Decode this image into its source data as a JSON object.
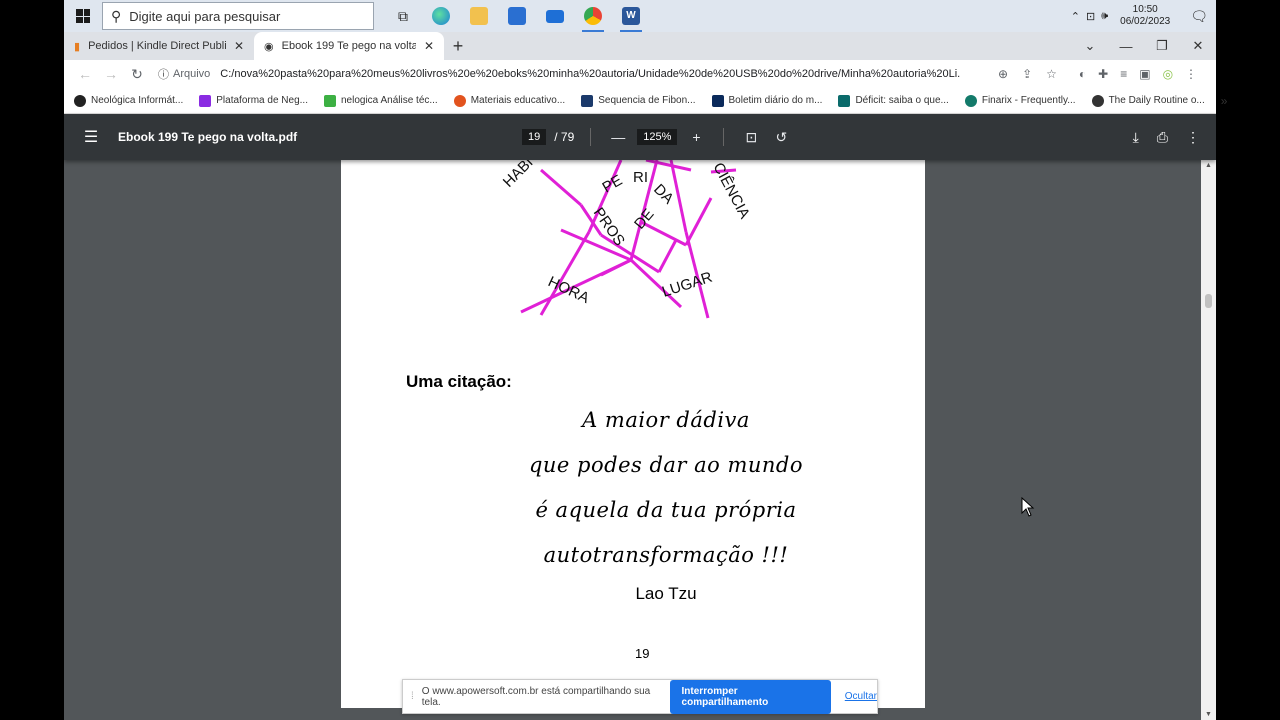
{
  "taskbar": {
    "search_placeholder": "Digite aqui para pesquisar",
    "time": "10:50",
    "date": "06/02/2023",
    "apps": [
      "task-view-icon",
      "edge-icon",
      "file-explorer-icon",
      "store-icon",
      "mail-icon",
      "chrome-icon",
      "word-icon"
    ]
  },
  "tabs": [
    {
      "title": "Pedidos | Kindle Direct Publishing",
      "active": false
    },
    {
      "title": "Ebook 199 Te pego na volta.pdf",
      "active": true
    }
  ],
  "address": {
    "label": "Arquivo",
    "url": "C:/nova%20pasta%20para%20meus%20livros%20e%20eboks%20minha%20autoria/Unidade%20de%20USB%20do%20drive/Minha%20autoria%20Li..."
  },
  "bookmarks": [
    {
      "label": "Neológica Informát...",
      "color": "#222222"
    },
    {
      "label": "Plataforma de Neg...",
      "color": "#8a2be2"
    },
    {
      "label": "nelogica Análise téc...",
      "color": "#3cb043"
    },
    {
      "label": "Materiais educativo...",
      "color": "#e2531e"
    },
    {
      "label": "Sequencia de Fibon...",
      "color": "#1b3a6b"
    },
    {
      "label": "Boletim diário do m...",
      "color": "#0b2a5b"
    },
    {
      "label": "Déficit: saiba o que...",
      "color": "#0b6b6b"
    },
    {
      "label": "Finarix - Frequently...",
      "color": "#137a6a"
    },
    {
      "label": "The Daily Routine o...",
      "color": "#333333"
    }
  ],
  "pdf": {
    "title": "Ebook 199 Te pego na volta.pdf",
    "current_page": "19",
    "total_pages": "/  79",
    "zoom": "125%"
  },
  "page": {
    "star_words": [
      "HABI",
      "PE",
      "RI",
      "DA",
      "CIÊNCIA",
      "PROS",
      "DE",
      "HORA",
      "LUGAR"
    ],
    "star_color": "#e020d6",
    "quote_heading": "Uma citação:",
    "quote_lines": [
      "A maior dádiva",
      "que podes dar ao  mundo",
      "é  aquela  da tua própria",
      "autotransformação !!!"
    ],
    "author": "Lao Tzu",
    "page_number": "19"
  },
  "share_bar": {
    "message": "O www.apowersoft.com.br está compartilhando sua tela.",
    "stop_button": "Interromper compartilhamento",
    "hide_link": "Ocultar"
  }
}
